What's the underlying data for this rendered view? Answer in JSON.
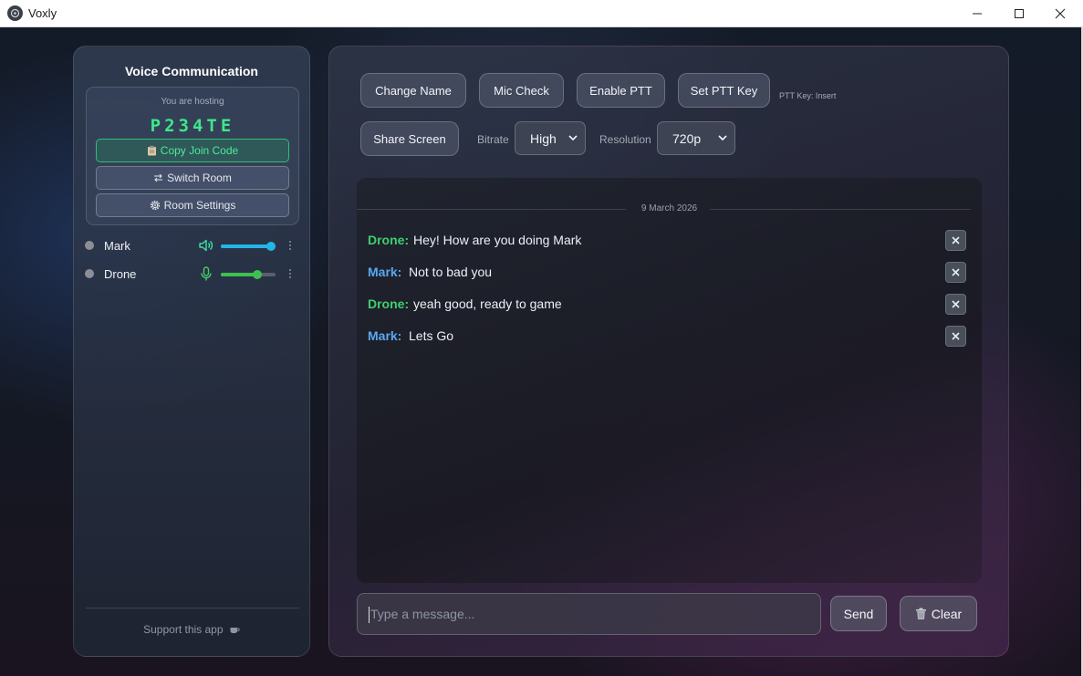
{
  "window": {
    "title": "Voxly",
    "icon": "voxly-logo-icon"
  },
  "sidebar": {
    "title": "Voice Communication",
    "hosting_label": "You are hosting",
    "join_code": "P234TE",
    "copy_label": "Copy Join Code",
    "switch_label": "Switch Room",
    "settings_label": "Room Settings",
    "users": [
      {
        "name": "Mark",
        "icon": "speaker-icon",
        "volume": 0.92,
        "accent": "#22b6e6",
        "status": "offline-gray"
      },
      {
        "name": "Drone",
        "icon": "microphone-icon",
        "volume": 0.66,
        "accent": "#3fbf4f",
        "status": "offline-gray"
      }
    ],
    "support_label": "Support this app"
  },
  "toolbar": {
    "change_name": "Change Name",
    "mic_check": "Mic Check",
    "enable_ptt": "Enable PTT",
    "set_ptt_key": "Set PTT Key",
    "ptt_key_label": "PTT Key: Insert",
    "share_screen": "Share Screen",
    "bitrate_label": "Bitrate",
    "bitrate_value": "High",
    "resolution_label": "Resolution",
    "resolution_value": "720p"
  },
  "chat": {
    "date": "9 March 2026",
    "messages": [
      {
        "author": "Drone:",
        "text": "Hey! How are you doing Mark",
        "color": "#3ecf6e"
      },
      {
        "author": "Mark:",
        "text": "Not to bad you",
        "color": "#5aa8f0"
      },
      {
        "author": "Drone:",
        "text": "yeah good, ready to game",
        "color": "#3ecf6e"
      },
      {
        "author": "Mark:",
        "text": "Lets Go",
        "color": "#5aa8f0"
      }
    ],
    "input_placeholder": "Type a message...",
    "send_label": "Send",
    "clear_label": "Clear"
  }
}
